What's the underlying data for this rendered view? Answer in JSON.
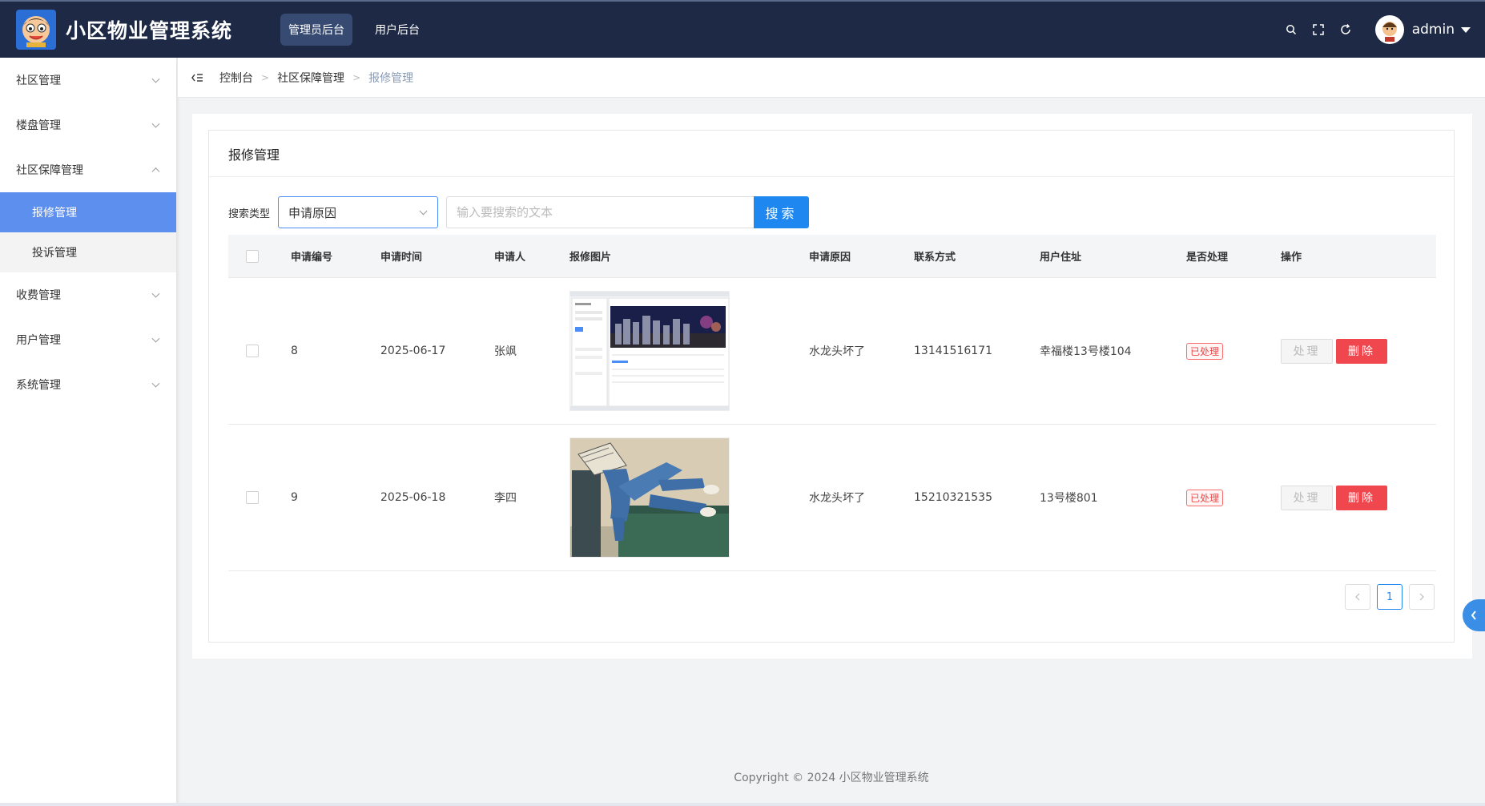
{
  "header": {
    "app_title": "小区物业管理系统",
    "tabs": [
      {
        "label": "管理员后台",
        "active": true
      },
      {
        "label": "用户后台",
        "active": false
      }
    ],
    "icons": [
      "search-icon",
      "fullscreen-icon",
      "refresh-icon"
    ],
    "username": "admin"
  },
  "sidebar": {
    "items": [
      {
        "label": "社区管理",
        "expanded": false
      },
      {
        "label": "楼盘管理",
        "expanded": false
      },
      {
        "label": "社区保障管理",
        "expanded": true,
        "children": [
          {
            "label": "报修管理",
            "active": true
          },
          {
            "label": "投诉管理",
            "active": false
          }
        ]
      },
      {
        "label": "收费管理",
        "expanded": false
      },
      {
        "label": "用户管理",
        "expanded": false
      },
      {
        "label": "系统管理",
        "expanded": false
      }
    ]
  },
  "breadcrumb": [
    "控制台",
    "社区保障管理",
    "报修管理"
  ],
  "card": {
    "title": "报修管理",
    "search": {
      "label": "搜索类型",
      "type_selected": "申请原因",
      "placeholder": "输入要搜索的文本",
      "value": "",
      "button": "搜索"
    }
  },
  "table": {
    "columns": [
      "申请编号",
      "申请时间",
      "申请人",
      "报修图片",
      "申请原因",
      "联系方式",
      "用户住址",
      "是否处理",
      "操作"
    ],
    "rows": [
      {
        "id": "8",
        "date": "2025-06-17",
        "applicant": "张飒",
        "image": "screenshot-thumbnail",
        "reason": "水龙头坏了",
        "phone": "13141516171",
        "address": "幸福楼13号楼104",
        "status": "已处理",
        "handle": "处理",
        "delete": "删除"
      },
      {
        "id": "9",
        "date": "2025-06-18",
        "applicant": "李四",
        "image": "illustration-thumbnail",
        "reason": "水龙头坏了",
        "phone": "15210321535",
        "address": "13号楼801",
        "status": "已处理",
        "handle": "处理",
        "delete": "删除"
      }
    ]
  },
  "pagination": {
    "current": "1"
  },
  "footer": "Copyright © 2024 小区物业管理系统",
  "colors": {
    "header_bg": "#1e2a45",
    "accent": "#1e88f0",
    "active_menu": "#5d8fef",
    "danger": "#f0464e"
  }
}
